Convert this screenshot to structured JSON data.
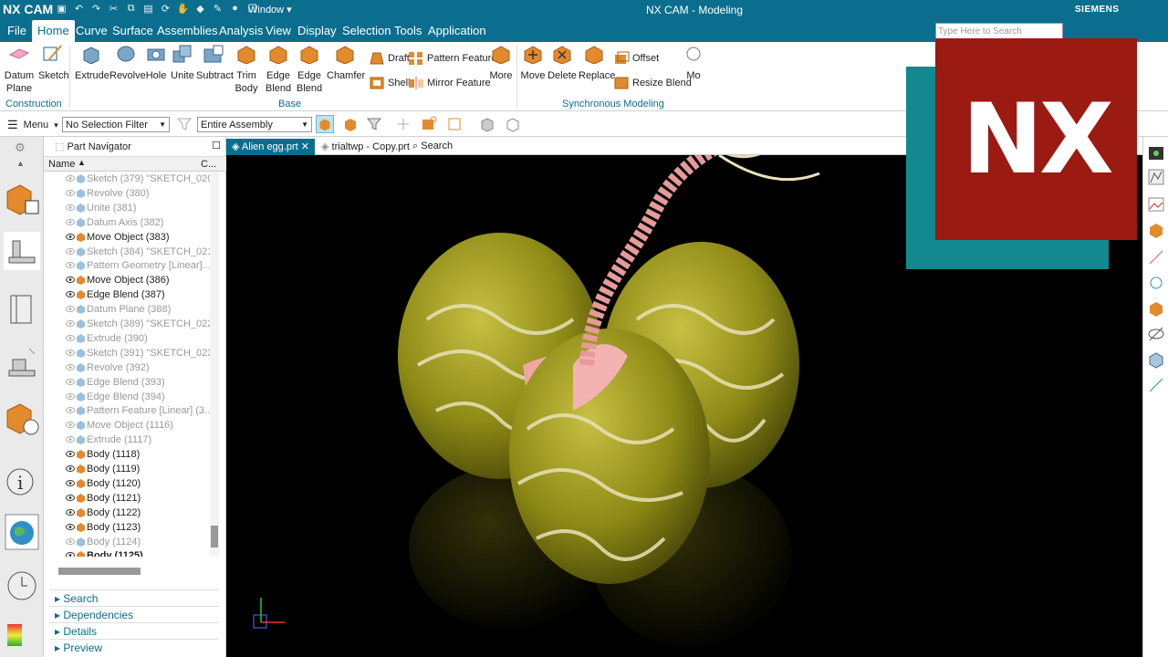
{
  "titlebar": {
    "app": "NX CAM",
    "window_menu": "Window",
    "caption": "NX CAM - Modeling",
    "brand": "SIEMENS"
  },
  "menu": [
    "File",
    "Home",
    "Curve",
    "Surface",
    "Assemblies",
    "Analysis",
    "View",
    "Display",
    "Selection",
    "Tools",
    "Application"
  ],
  "search": {
    "placeholder": "Type Here to Search"
  },
  "ribbon": {
    "datum_plane": "Datum Plane",
    "sketch": "Sketch",
    "construction": "Construction",
    "extrude": "Extrude",
    "revolve": "Revolve",
    "hole": "Hole",
    "unite": "Unite",
    "subtract": "Subtract",
    "trim_body": "Trim Body",
    "edge_blend": "Edge Blend",
    "edge_blend2": "Edge Blend",
    "chamfer": "Chamfer",
    "draft": "Draft",
    "shell": "Shell",
    "pattern_feature": "Pattern Feature",
    "mirror_feature": "Mirror Feature",
    "more": "More",
    "base": "Base",
    "move": "Move",
    "delete": "Delete",
    "replace": "Replace",
    "offset": "Offset",
    "resize_blend": "Resize Blend",
    "more2": "Mo",
    "sync_modeling": "Synchronous Modeling"
  },
  "toolbar": {
    "menu": "Menu",
    "selection_filter": "No Selection Filter",
    "scope": "Entire Assembly"
  },
  "navigator": {
    "title": "Part Navigator",
    "col_name": "Name",
    "col_c": "C...",
    "rows": [
      {
        "label": "Sketch (379) \"SKETCH_020\"",
        "dim": true
      },
      {
        "label": "Revolve (380)",
        "dim": true
      },
      {
        "label": "Unite (381)",
        "dim": true
      },
      {
        "label": "Datum Axis (382)",
        "dim": true
      },
      {
        "label": "Move Object (383)",
        "dim": false
      },
      {
        "label": "Sketch (384) \"SKETCH_021\"",
        "dim": true
      },
      {
        "label": "Pattern Geometry [Linear]...",
        "dim": true
      },
      {
        "label": "Move Object (386)",
        "dim": false
      },
      {
        "label": "Edge Blend (387)",
        "dim": false
      },
      {
        "label": "Datum Plane (388)",
        "dim": true
      },
      {
        "label": "Sketch (389) \"SKETCH_022\"",
        "dim": true
      },
      {
        "label": "Extrude (390)",
        "dim": true
      },
      {
        "label": "Sketch (391) \"SKETCH_023\"",
        "dim": true
      },
      {
        "label": "Revolve (392)",
        "dim": true
      },
      {
        "label": "Edge Blend (393)",
        "dim": true
      },
      {
        "label": "Edge Blend (394)",
        "dim": true
      },
      {
        "label": "Pattern Feature [Linear] (3...",
        "dim": true
      },
      {
        "label": "Move Object (1116)",
        "dim": true
      },
      {
        "label": "Extrude (1117)",
        "dim": true
      },
      {
        "label": "Body (1118)",
        "dim": false
      },
      {
        "label": "Body (1119)",
        "dim": false
      },
      {
        "label": "Body (1120)",
        "dim": false
      },
      {
        "label": "Body (1121)",
        "dim": false
      },
      {
        "label": "Body (1122)",
        "dim": false
      },
      {
        "label": "Body (1123)",
        "dim": false
      },
      {
        "label": "Body (1124)",
        "dim": true
      },
      {
        "label": "Body (1125)",
        "dim": false
      }
    ],
    "panels": [
      "Search",
      "Dependencies",
      "Details",
      "Preview"
    ]
  },
  "tabs": [
    "Alien egg.prt",
    "trialtwp - Copy.prt",
    "Search"
  ],
  "logo": "NX",
  "colors": {
    "accent": "#0b6e8e",
    "logo_red": "#9b1a12",
    "logo_teal": "#11898f",
    "egg": "#8e8a16"
  }
}
